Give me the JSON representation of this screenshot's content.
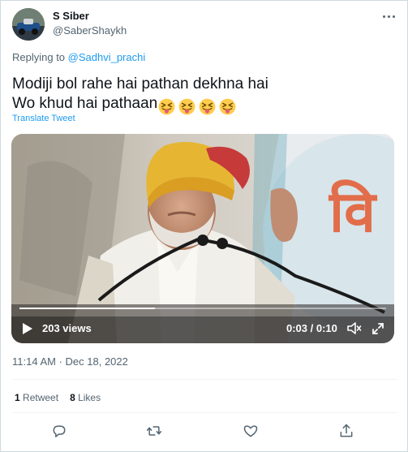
{
  "author": {
    "name": "S Siber",
    "handle": "@SaberShaykh"
  },
  "reply": {
    "prefix": "Replying to ",
    "to": "@Sadhvi_prachi"
  },
  "tweet": {
    "line1": "Modiji bol rahe hai pathan dekhna hai",
    "line2": "Wo khud hai pathaan",
    "emojis": [
      "squinting-tongue-emoji",
      "squinting-tongue-emoji",
      "squinting-tongue-emoji",
      "squinting-tongue-emoji"
    ],
    "translate_label": "Translate Tweet"
  },
  "video": {
    "views": "203 views",
    "current_time": "0:03",
    "separator": " / ",
    "duration": "0:10",
    "progress_fraction": 0.37,
    "banner_text": "वि"
  },
  "timestamp": {
    "time": "11:14 AM",
    "separator": " · ",
    "date": "Dec 18, 2022"
  },
  "stats": {
    "retweets_count": "1",
    "retweets_label": "Retweet",
    "likes_count": "8",
    "likes_label": "Likes"
  },
  "actions": [
    "reply-icon",
    "retweet-icon",
    "like-icon",
    "share-icon"
  ],
  "colors": {
    "accent": "#1d9bf0",
    "text": "#0f1419",
    "muted": "#536471",
    "border": "#cfd9de"
  }
}
